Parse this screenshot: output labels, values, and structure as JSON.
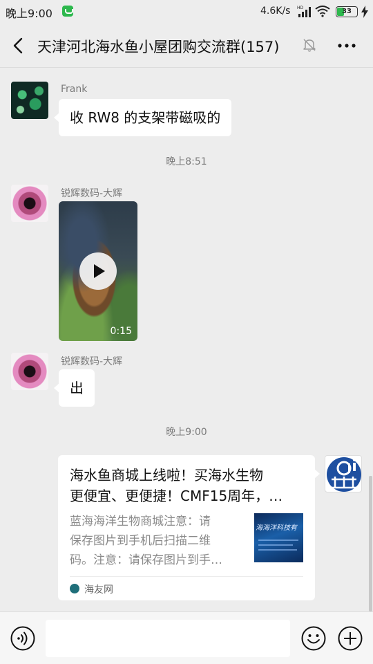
{
  "status_bar": {
    "time": "晚上9:00",
    "network_speed": "4.6K/s",
    "battery_level": "33"
  },
  "header": {
    "title": "天津河北海水鱼小屋团购交流群(157)"
  },
  "messages": [
    {
      "sender": "Frank",
      "type": "text",
      "text": "收 RW8 的支架带磁吸的"
    },
    {
      "type": "time",
      "text": "晚上8:51"
    },
    {
      "sender": "锐辉数码-大辉",
      "type": "video",
      "duration": "0:15"
    },
    {
      "sender": "锐辉数码-大辉",
      "type": "text",
      "text": "出"
    },
    {
      "type": "time",
      "text": "晚上9:00"
    },
    {
      "sender": "self",
      "type": "link_card",
      "title_line1": "海水鱼商城上线啦！买海水生物",
      "title_line2": "更便宜、更便捷！CMF15周年，…",
      "desc_line1": "蓝海海洋生物商城注意：请",
      "desc_line2": "保存图片到手机后扫描二维",
      "desc_line3": "码。注意：请保存图片到手…",
      "thumbnail_text": "海海洋科技有",
      "source": "海友网"
    }
  ],
  "colors": {
    "background": "#ededed",
    "bubble": "#ffffff",
    "accent_green": "#2db84d"
  },
  "icons": [
    "back-arrow-icon",
    "mute-bell-icon",
    "more-dots-icon",
    "voice-icon",
    "emoji-icon",
    "plus-icon",
    "play-icon"
  ]
}
